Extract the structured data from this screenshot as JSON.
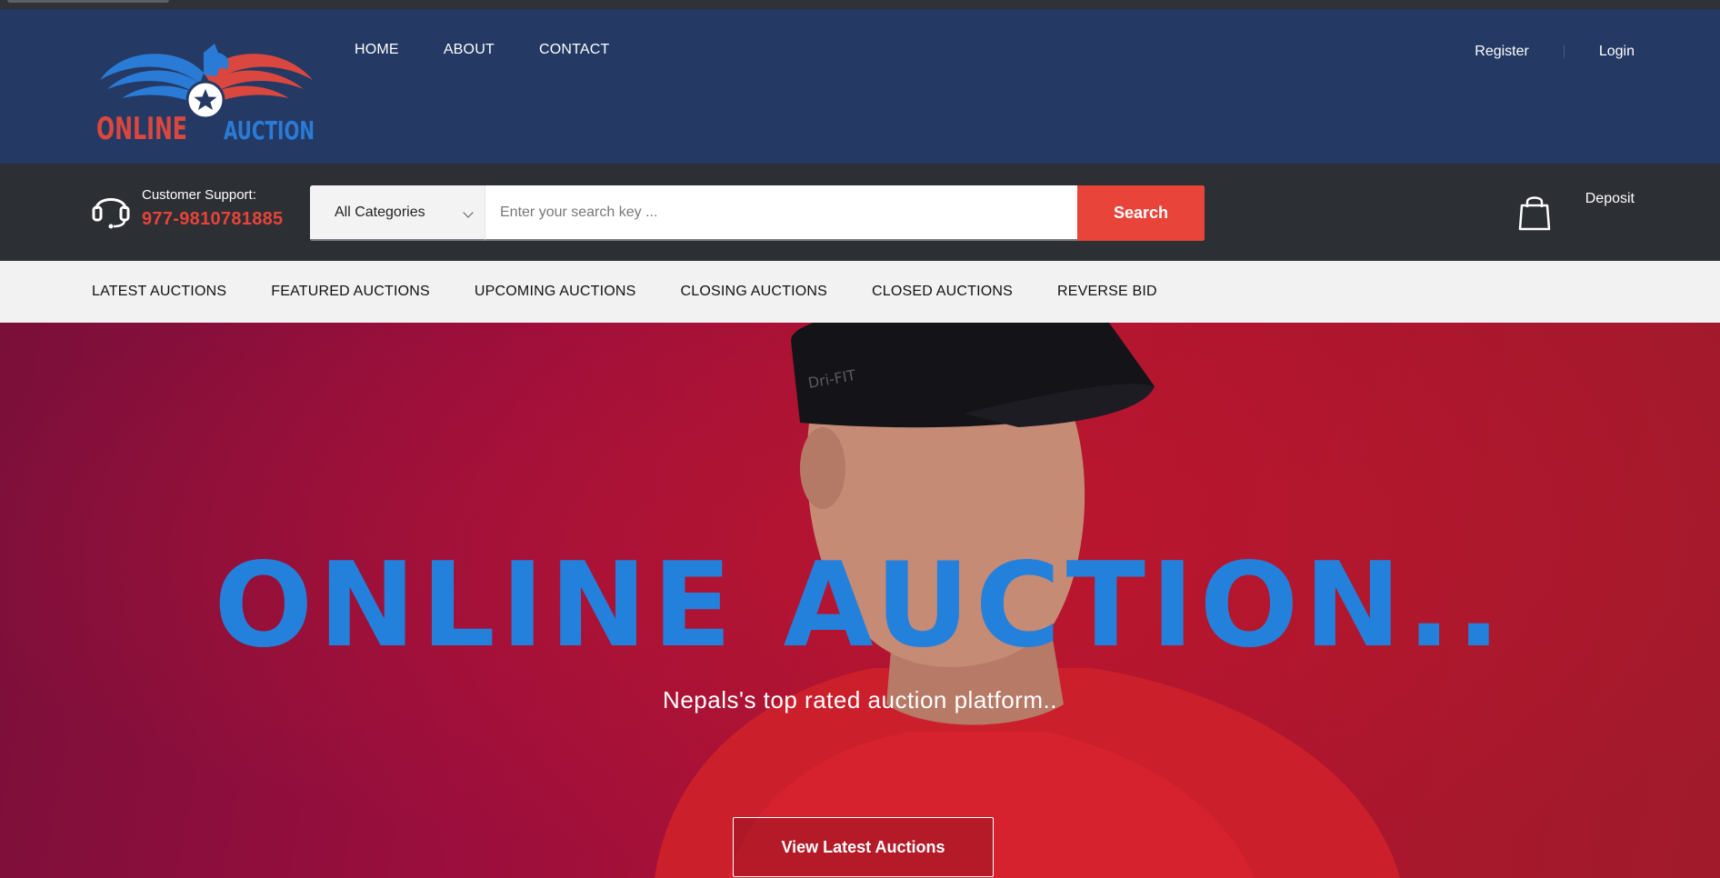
{
  "header": {
    "logo": {
      "word1": "ONLINE",
      "word2": "AUCTION"
    },
    "nav": [
      "HOME",
      "ABOUT",
      "CONTACT"
    ],
    "auth": {
      "register": "Register",
      "login": "Login"
    }
  },
  "searchbar": {
    "support_label": "Customer Support:",
    "support_phone": "977-9810781885",
    "category_selected": "All Categories",
    "search_placeholder": "Enter your search key ...",
    "search_button": "Search",
    "deposit_label": "Deposit"
  },
  "category_nav": [
    "LATEST AUCTIONS",
    "FEATURED AUCTIONS",
    "UPCOMING AUCTIONS",
    "CLOSING AUCTIONS",
    "CLOSED AUCTIONS",
    "REVERSE BID"
  ],
  "hero": {
    "title": "ONLINE AUCTION..",
    "subtitle": "Nepals's top rated auction platform..",
    "cta": "View Latest Auctions",
    "cap_text": "Dri-FIT"
  },
  "colors": {
    "header_bg": "#243963",
    "searchbar_bg": "#2c2f34",
    "accent_red": "#e8443a",
    "hero_title_blue": "#2381dc",
    "logo_red": "#d9473f",
    "logo_blue": "#2a7bd6"
  }
}
